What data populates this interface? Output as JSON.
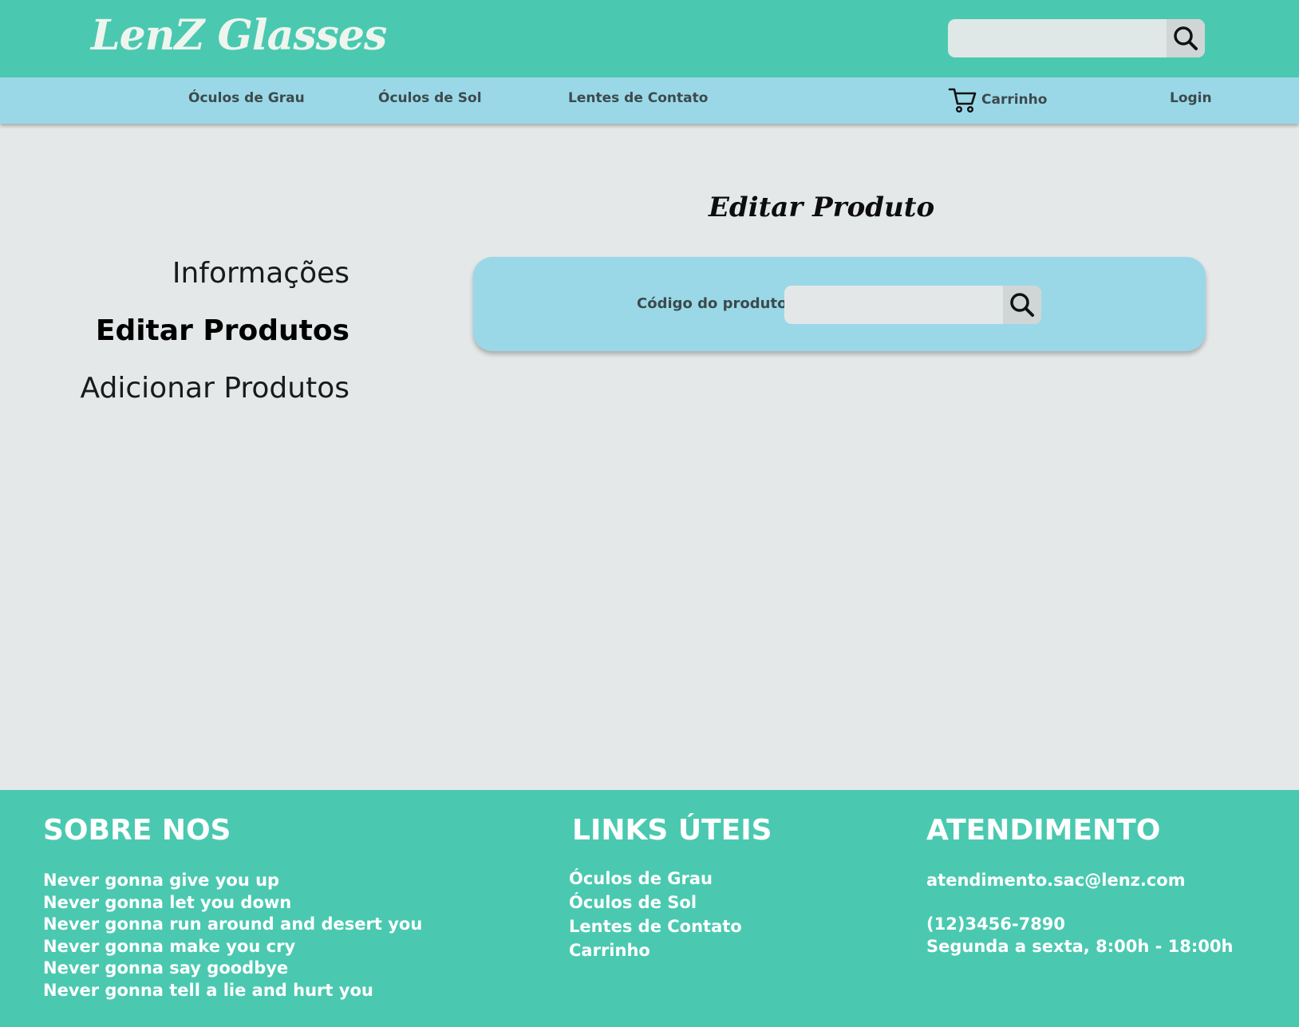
{
  "header": {
    "logo": "LenZ  Glasses",
    "search_placeholder": "",
    "search_icon": "search-icon"
  },
  "nav": {
    "items": [
      "Óculos de Grau",
      "Óculos de Sol",
      "Lentes de Contato"
    ],
    "cart_label": "Carrinho",
    "cart_icon": "cart-icon",
    "login_label": "Login"
  },
  "sidebar": {
    "items": [
      "Informações",
      "Editar Produtos",
      "Adicionar Produtos"
    ],
    "active": "Editar Produtos"
  },
  "main": {
    "title": "Editar Produto",
    "code_label": "Código do produto:",
    "code_value": "",
    "search_icon": "search-icon"
  },
  "footer": {
    "about": {
      "heading": "SOBRE NOS",
      "lines": [
        "Never gonna give you up",
        "Never gonna let you down",
        "Never gonna run around and desert you",
        "Never gonna make you cry",
        "Never gonna say goodbye",
        "Never gonna tell a lie and hurt you"
      ]
    },
    "links": {
      "heading": "LINKS ÚTEIS",
      "items": [
        "Óculos de Grau",
        "Óculos de Sol",
        "Lentes de Contato",
        "Carrinho"
      ]
    },
    "service": {
      "heading": "ATENDIMENTO",
      "email": "atendimento.sac@lenz.com",
      "phone": "(12)3456-7890",
      "hours": "Segunda a sexta, 8:00h - 18:00h"
    }
  },
  "colors": {
    "teal": "#4ac9b0",
    "light_blue": "#9ad8e8",
    "background": "#e4e8e9",
    "nav_text": "#3d4a4c"
  }
}
